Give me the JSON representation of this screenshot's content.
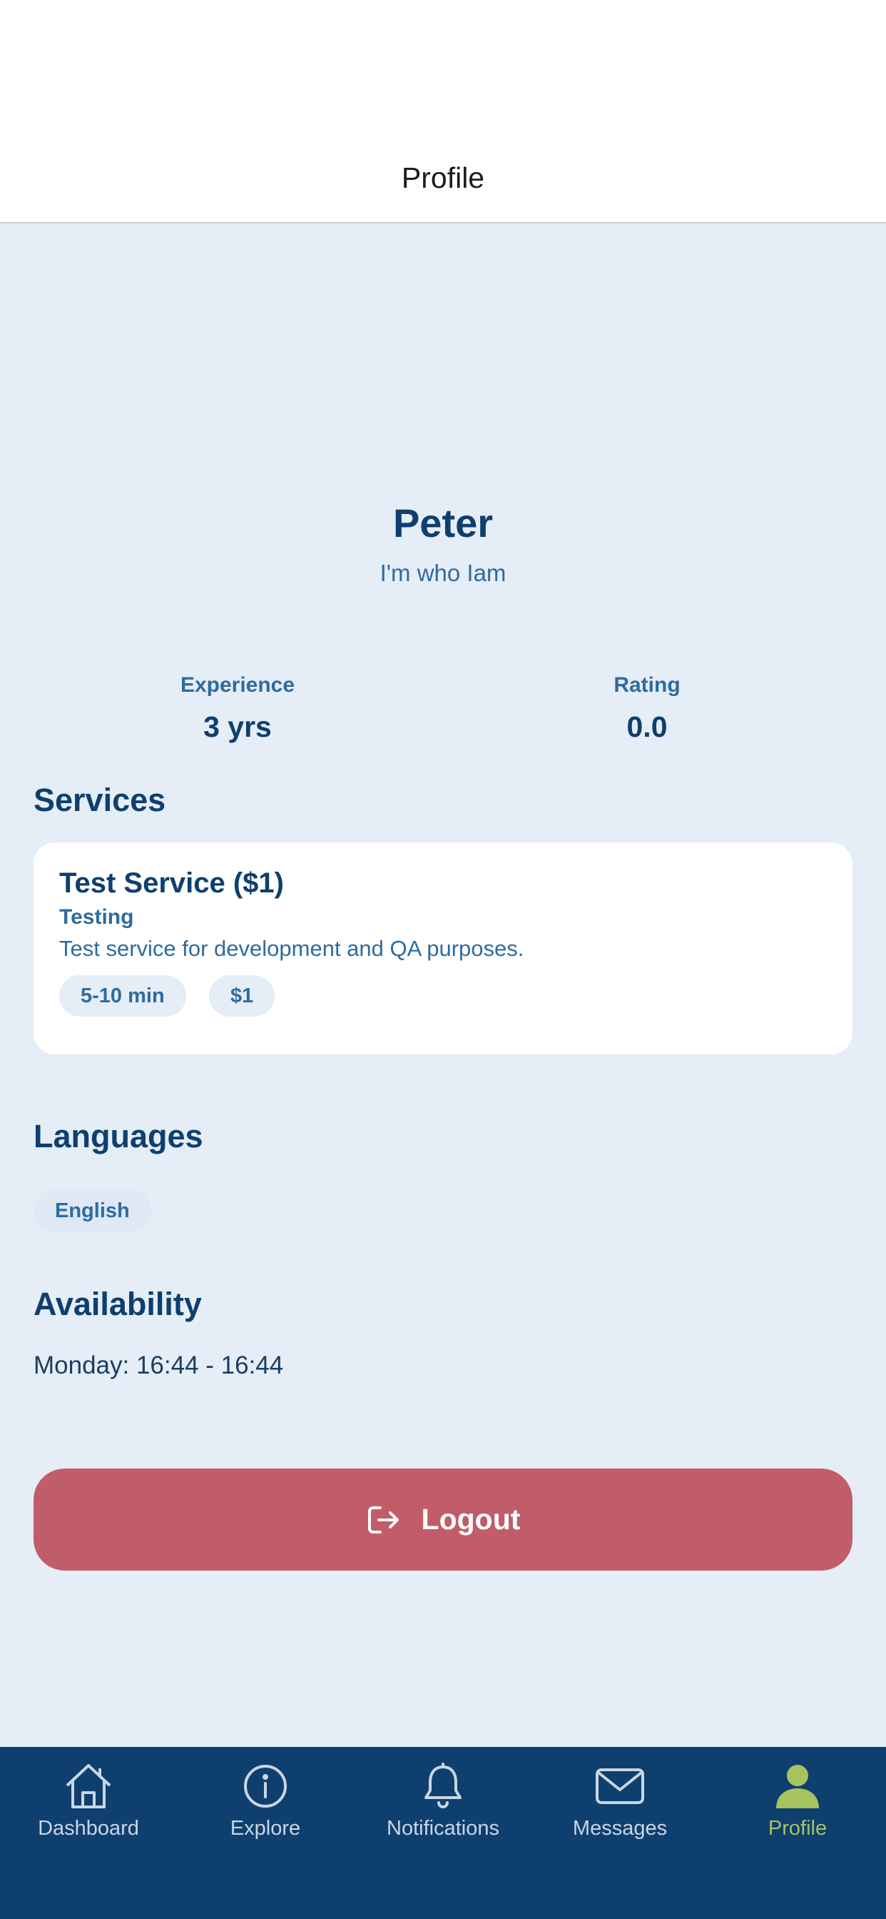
{
  "header": {
    "title": "Profile"
  },
  "profile": {
    "name": "Peter",
    "tagline": "I'm who Iam"
  },
  "stats": {
    "experience": {
      "label": "Experience",
      "value": "3 yrs"
    },
    "rating": {
      "label": "Rating",
      "value": "0.0"
    }
  },
  "services": {
    "title": "Services",
    "items": [
      {
        "title": "Test Service ($1)",
        "category": "Testing",
        "description": "Test service for development and QA purposes.",
        "duration": "5-10 min",
        "price": "$1"
      }
    ]
  },
  "languages": {
    "title": "Languages",
    "items": [
      "English"
    ]
  },
  "availability": {
    "title": "Availability",
    "items": [
      "Monday: 16:44 - 16:44"
    ]
  },
  "logout": {
    "label": "Logout",
    "icon": "logout-icon"
  },
  "tabbar": {
    "tabs": [
      {
        "label": "Dashboard",
        "icon": "home-icon"
      },
      {
        "label": "Explore",
        "icon": "info-icon"
      },
      {
        "label": "Notifications",
        "icon": "bell-icon"
      },
      {
        "label": "Messages",
        "icon": "mail-icon"
      },
      {
        "label": "Profile",
        "icon": "person-icon",
        "active": true
      }
    ]
  },
  "colors": {
    "background": "#e5edf7",
    "primary": "#0f3f6e",
    "secondary": "#2e6c9e",
    "danger": "#c05d69",
    "active_tab": "#a6c35e"
  }
}
